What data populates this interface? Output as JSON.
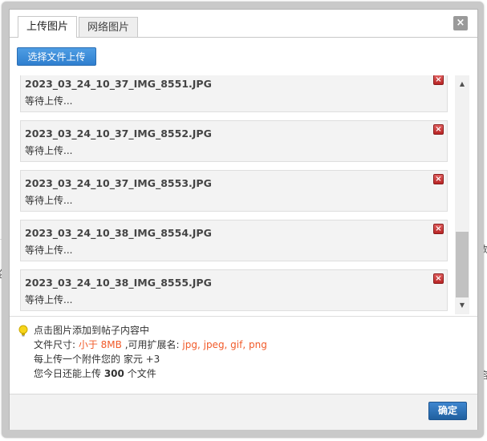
{
  "tabs": [
    {
      "label": "上传图片",
      "active": true
    },
    {
      "label": "网络图片",
      "active": false
    }
  ],
  "close_icon": {
    "glyph": "×",
    "name": "close-icon"
  },
  "upload_button": {
    "label": "选择文件上传"
  },
  "files": [
    {
      "name": "2023_03_24_10_37_IMG_8551.JPG",
      "status": "等待上传..."
    },
    {
      "name": "2023_03_24_10_37_IMG_8552.JPG",
      "status": "等待上传..."
    },
    {
      "name": "2023_03_24_10_37_IMG_8553.JPG",
      "status": "等待上传..."
    },
    {
      "name": "2023_03_24_10_38_IMG_8554.JPG",
      "status": "等待上传..."
    },
    {
      "name": "2023_03_24_10_38_IMG_8555.JPG",
      "status": "等待上传..."
    }
  ],
  "remove_icon": {
    "glyph": "×",
    "name": "remove-icon"
  },
  "scrollbar": {
    "up_glyph": "▲",
    "down_glyph": "▼"
  },
  "info": {
    "tip": "点击图片添加到帖子内容中",
    "size_label": "文件尺寸: ",
    "size_value": "小于 8MB",
    "ext_label": " ,可用扩展名: ",
    "ext_value": "jpg, jpeg, gif, png",
    "reward": "每上传一个附件您的 家元 +3",
    "quota_prefix": "您今日还能上传 ",
    "quota_value": "300",
    "quota_suffix": " 个文件"
  },
  "background_fragments": {
    "right_top": "数",
    "left_mid": "论",
    "right_mid": "容",
    "right_bottom": "，叫"
  },
  "ok_button": {
    "label": "确定"
  },
  "colors": {
    "accent_blue": "#2f7fcf",
    "ok_blue": "#20609f",
    "highlight_orange": "#f15a29",
    "remove_red": "#b82424"
  }
}
